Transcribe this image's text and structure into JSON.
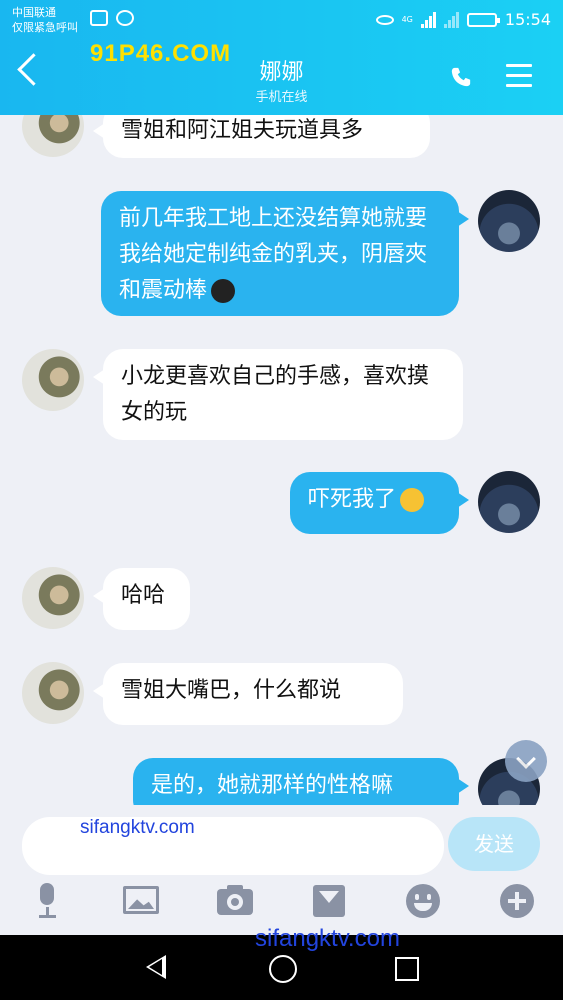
{
  "status_bar": {
    "carrier": "中国联通",
    "emergency": "仅限紧急呼叫",
    "time": "15:54",
    "network": "4G"
  },
  "header": {
    "title": "娜娜",
    "subtitle": "手机在线"
  },
  "messages": [
    {
      "from": "her",
      "text": "雪姐和阿江姐夫玩道具多"
    },
    {
      "from": "me",
      "text": "前几年我工地上还没结算她就要我给她定制纯金的乳夹，阴唇夾和震动棒",
      "emoji": "bug-emoji"
    },
    {
      "from": "her",
      "text": "小龙更喜欢自己的手感，喜欢摸女的玩"
    },
    {
      "from": "me",
      "text": "吓死我了",
      "emoji": "thinking-emoji"
    },
    {
      "from": "her",
      "text": "哈哈"
    },
    {
      "from": "her",
      "text": "雪姐大嘴巴，什么都说"
    },
    {
      "from": "me",
      "text": "是的，她就那样的性格嘛"
    }
  ],
  "input": {
    "value": "",
    "send_label": "发送"
  },
  "toolbar_icons": [
    "microphone-icon",
    "image-icon",
    "camera-icon",
    "envelope-icon",
    "smiley-icon",
    "plus-icon"
  ],
  "watermarks": {
    "top": "91P46.COM",
    "input": "sifangktv.com",
    "bottom": "sifangktv.com"
  },
  "colors": {
    "header": "#19b7f0",
    "outgoing_bubble": "#2ab3ef",
    "incoming_bubble": "#ffffff",
    "background": "#eef0f6"
  }
}
